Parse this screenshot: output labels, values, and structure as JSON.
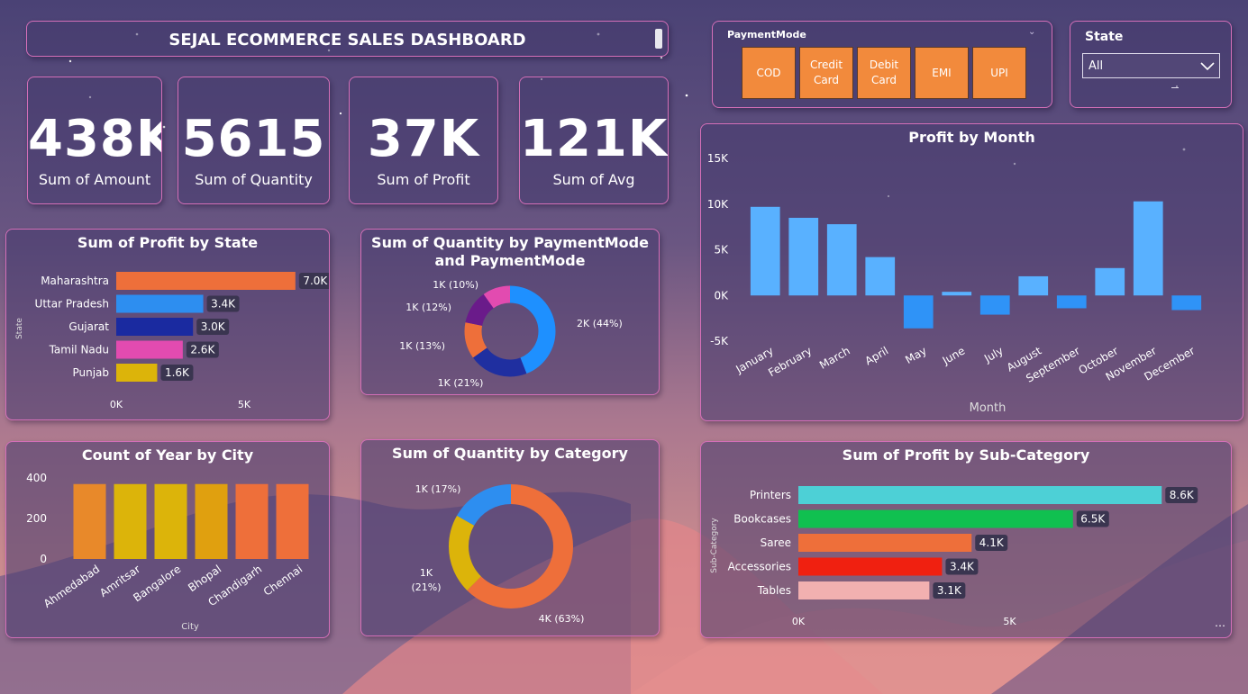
{
  "title": "SEJAL ECOMMERCE SALES DASHBOARD",
  "kpis": [
    {
      "value": "438K",
      "label": "Sum of Amount"
    },
    {
      "value": "5615",
      "label": "Sum of Quantity"
    },
    {
      "value": "37K",
      "label": "Sum of Profit"
    },
    {
      "value": "121K",
      "label": "Sum of Avg"
    }
  ],
  "payment_slicer": {
    "label": "PaymentMode",
    "options": [
      "COD",
      "Credit Card",
      "Debit Card",
      "EMI",
      "UPI"
    ]
  },
  "state_slicer": {
    "label": "State",
    "selected": "All"
  },
  "colors": {
    "accent_border": "#d46fb8",
    "button_orange": "#f28a3c",
    "bar_blue": "#59b1ff"
  },
  "chart_data": [
    {
      "type": "bar",
      "orientation": "horizontal",
      "title": "Sum of Profit by State",
      "ylabel": "State",
      "categories": [
        "Maharashtra",
        "Uttar Pradesh",
        "Gujarat",
        "Tamil Nadu",
        "Punjab"
      ],
      "values": [
        7000,
        3400,
        3000,
        2600,
        1600
      ],
      "data_labels": [
        "7.0K",
        "3.4K",
        "3.0K",
        "2.6K",
        "1.6K"
      ],
      "colors": [
        "#ee6f3a",
        "#2d8ef0",
        "#1a2aa0",
        "#e24bb0",
        "#dcb40a"
      ],
      "xticks": [
        "0K",
        "5K"
      ],
      "xlim": [
        0,
        7500
      ]
    },
    {
      "type": "pie",
      "variant": "donut",
      "title": "Sum of Quantity by PaymentMode and PaymentMode",
      "labels": [
        "2K (44%)",
        "1K (21%)",
        "1K (13%)",
        "1K (12%)",
        "1K (10%)"
      ],
      "values": [
        44,
        21,
        13,
        12,
        10
      ],
      "colors": [
        "#1e90ff",
        "#1f2fa0",
        "#ee6f3a",
        "#6a1b8a",
        "#e24bb0"
      ]
    },
    {
      "type": "bar",
      "title": "Profit by Month",
      "xlabel": "Month",
      "categories": [
        "January",
        "February",
        "March",
        "April",
        "May",
        "June",
        "July",
        "August",
        "September",
        "October",
        "November",
        "December"
      ],
      "values": [
        9700,
        8500,
        7800,
        4200,
        -3600,
        400,
        -2100,
        2100,
        -1400,
        3000,
        10300,
        -1600
      ],
      "yticks": [
        "15K",
        "10K",
        "5K",
        "0K",
        "-5K"
      ],
      "ylim": [
        -5000,
        15000
      ],
      "color": "#59b1ff"
    },
    {
      "type": "bar",
      "title": "Count of Year by City",
      "xlabel": "City",
      "categories": [
        "Ahmedabad",
        "Amritsar",
        "Bangalore",
        "Bhopal",
        "Chandigarh",
        "Chennai"
      ],
      "values": [
        370,
        370,
        370,
        370,
        370,
        370
      ],
      "colors": [
        "#e8892a",
        "#dcb40a",
        "#dcb40a",
        "#e0a00f",
        "#ee6f3a",
        "#ee6f3a"
      ],
      "yticks": [
        "400",
        "200",
        "0"
      ],
      "ylim": [
        0,
        400
      ]
    },
    {
      "type": "pie",
      "variant": "donut",
      "title": "Sum of Quantity by Category",
      "labels": [
        "4K (63%)",
        "1K (21%)",
        "1K (17%)"
      ],
      "values": [
        63,
        21,
        17
      ],
      "colors": [
        "#ee6f3a",
        "#dcb40a",
        "#2d8ef0"
      ]
    },
    {
      "type": "bar",
      "orientation": "horizontal",
      "title": "Sum of Profit by Sub-Category",
      "ylabel": "Sub-Category",
      "categories": [
        "Printers",
        "Bookcases",
        "Saree",
        "Accessories",
        "Tables"
      ],
      "values": [
        8600,
        6500,
        4100,
        3400,
        3100
      ],
      "data_labels": [
        "8.6K",
        "6.5K",
        "4.1K",
        "3.4K",
        "3.1K"
      ],
      "colors": [
        "#4dd0d6",
        "#10c050",
        "#ee6f3a",
        "#f02010",
        "#f2b0b0"
      ],
      "xticks": [
        "0K",
        "5K"
      ],
      "xlim": [
        0,
        9000
      ]
    }
  ]
}
